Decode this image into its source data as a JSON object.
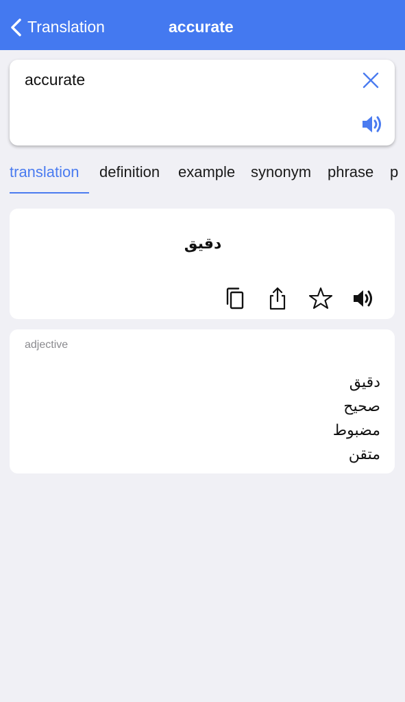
{
  "nav": {
    "back_label": "Translation",
    "title": "accurate"
  },
  "input": {
    "query": "accurate",
    "clear_icon": "close-icon",
    "speak_icon": "speaker-icon"
  },
  "tabs": [
    {
      "label": "translation",
      "active": true
    },
    {
      "label": "definition",
      "active": false
    },
    {
      "label": "example",
      "active": false
    },
    {
      "label": "synonym",
      "active": false
    },
    {
      "label": "phrase",
      "active": false
    },
    {
      "label": "p",
      "active": false
    }
  ],
  "result": {
    "translation": "دقيق",
    "actions": [
      "copy-icon",
      "share-icon",
      "star-icon",
      "speaker-icon"
    ]
  },
  "pos_section": {
    "part_of_speech": "adjective",
    "meanings": [
      "دقيق",
      "صحيح",
      "مضبوط",
      "متقن"
    ]
  },
  "colors": {
    "accent": "#4479f0",
    "background": "#f0f0f5",
    "card": "#ffffff"
  }
}
